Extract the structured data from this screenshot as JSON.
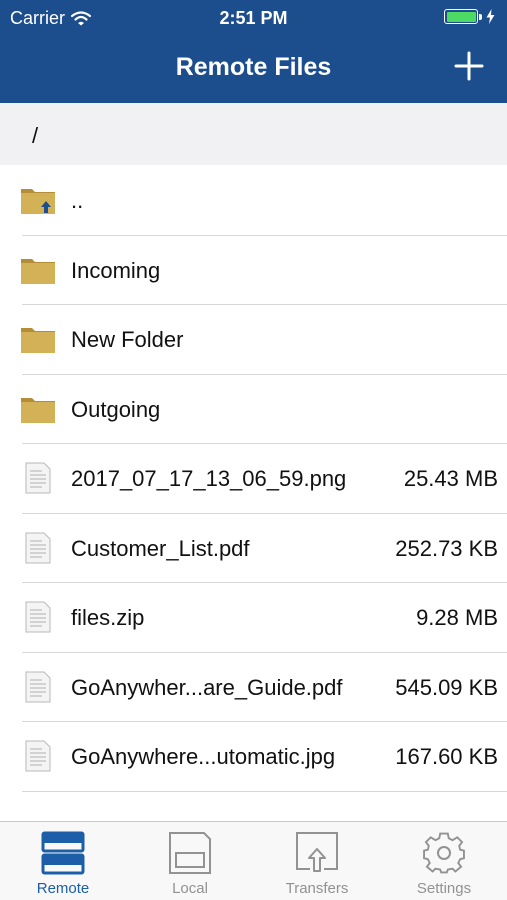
{
  "status_bar": {
    "carrier": "Carrier",
    "time": "2:51 PM"
  },
  "nav": {
    "title": "Remote Files",
    "add_icon": "plus-icon"
  },
  "path": "/",
  "files": [
    {
      "type": "parent-folder",
      "icon": "folder-up-icon",
      "name": "..",
      "size": ""
    },
    {
      "type": "folder",
      "icon": "folder-icon",
      "name": "Incoming",
      "size": ""
    },
    {
      "type": "folder",
      "icon": "folder-icon",
      "name": "New Folder",
      "size": ""
    },
    {
      "type": "folder",
      "icon": "folder-icon",
      "name": "Outgoing",
      "size": ""
    },
    {
      "type": "file",
      "icon": "file-icon",
      "name": "2017_07_17_13_06_59.png",
      "size": "25.43 MB"
    },
    {
      "type": "file",
      "icon": "file-icon",
      "name": "Customer_List.pdf",
      "size": "252.73 KB"
    },
    {
      "type": "file",
      "icon": "file-icon",
      "name": "files.zip",
      "size": "9.28 MB"
    },
    {
      "type": "file",
      "icon": "file-icon",
      "name": "GoAnywher...are_Guide.pdf",
      "size": "545.09 KB"
    },
    {
      "type": "file",
      "icon": "file-icon",
      "name": "GoAnywhere...utomatic.jpg",
      "size": "167.60 KB"
    }
  ],
  "tabs": [
    {
      "label": "Remote",
      "icon": "server-icon",
      "active": true
    },
    {
      "label": "Local",
      "icon": "device-icon",
      "active": false
    },
    {
      "label": "Transfers",
      "icon": "upload-icon",
      "active": false
    },
    {
      "label": "Settings",
      "icon": "gear-icon",
      "active": false
    }
  ],
  "colors": {
    "header": "#1c4d8c",
    "active_tab": "#1c5fa8",
    "inactive_tab": "#929292",
    "folder": "#c9a84a",
    "battery": "#4cd964"
  }
}
